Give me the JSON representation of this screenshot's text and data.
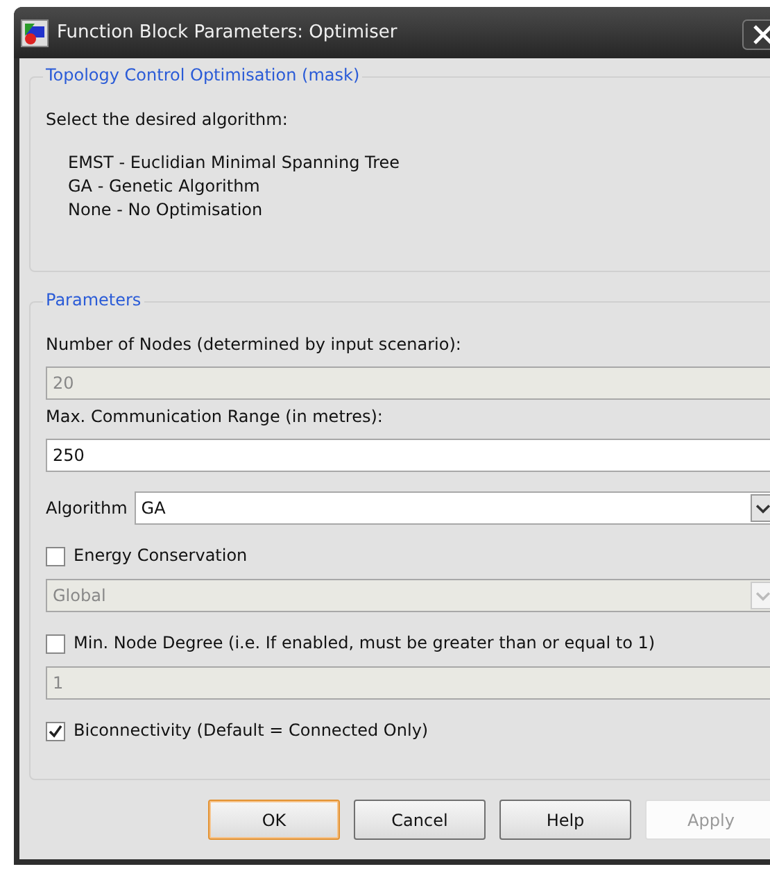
{
  "window": {
    "title": "Function Block Parameters: Optimiser"
  },
  "mask_group": {
    "title": "Topology Control Optimisation (mask)",
    "description": "Select the desired algorithm:",
    "options": [
      "EMST - Euclidian Minimal Spanning Tree",
      "GA - Genetic Algorithm",
      "None - No Optimisation"
    ]
  },
  "parameters": {
    "title": "Parameters",
    "fields": [
      {
        "kind": "text",
        "label": "Number of Nodes (determined by input scenario):",
        "value": "20",
        "disabled": true
      },
      {
        "kind": "text",
        "label": "Max. Communication Range (in metres):",
        "value": "250",
        "disabled": false
      },
      {
        "kind": "select",
        "label": "Algorithm",
        "value": "GA",
        "disabled": false
      },
      {
        "kind": "checkbox",
        "label": "Energy Conservation",
        "checked": false
      },
      {
        "kind": "select",
        "value": "Global",
        "disabled": true
      },
      {
        "kind": "checkbox",
        "label": "Min. Node Degree (i.e. If enabled, must be greater than or equal to 1)",
        "checked": false
      },
      {
        "kind": "text",
        "value": "1",
        "disabled": true
      },
      {
        "kind": "checkbox",
        "label": "Biconnectivity (Default = Connected Only)",
        "checked": true
      }
    ]
  },
  "buttons": [
    {
      "label": "OK",
      "default": true,
      "disabled": false
    },
    {
      "label": "Cancel",
      "default": false,
      "disabled": false
    },
    {
      "label": "Help",
      "default": false,
      "disabled": false
    },
    {
      "label": "Apply",
      "default": false,
      "disabled": true
    }
  ]
}
